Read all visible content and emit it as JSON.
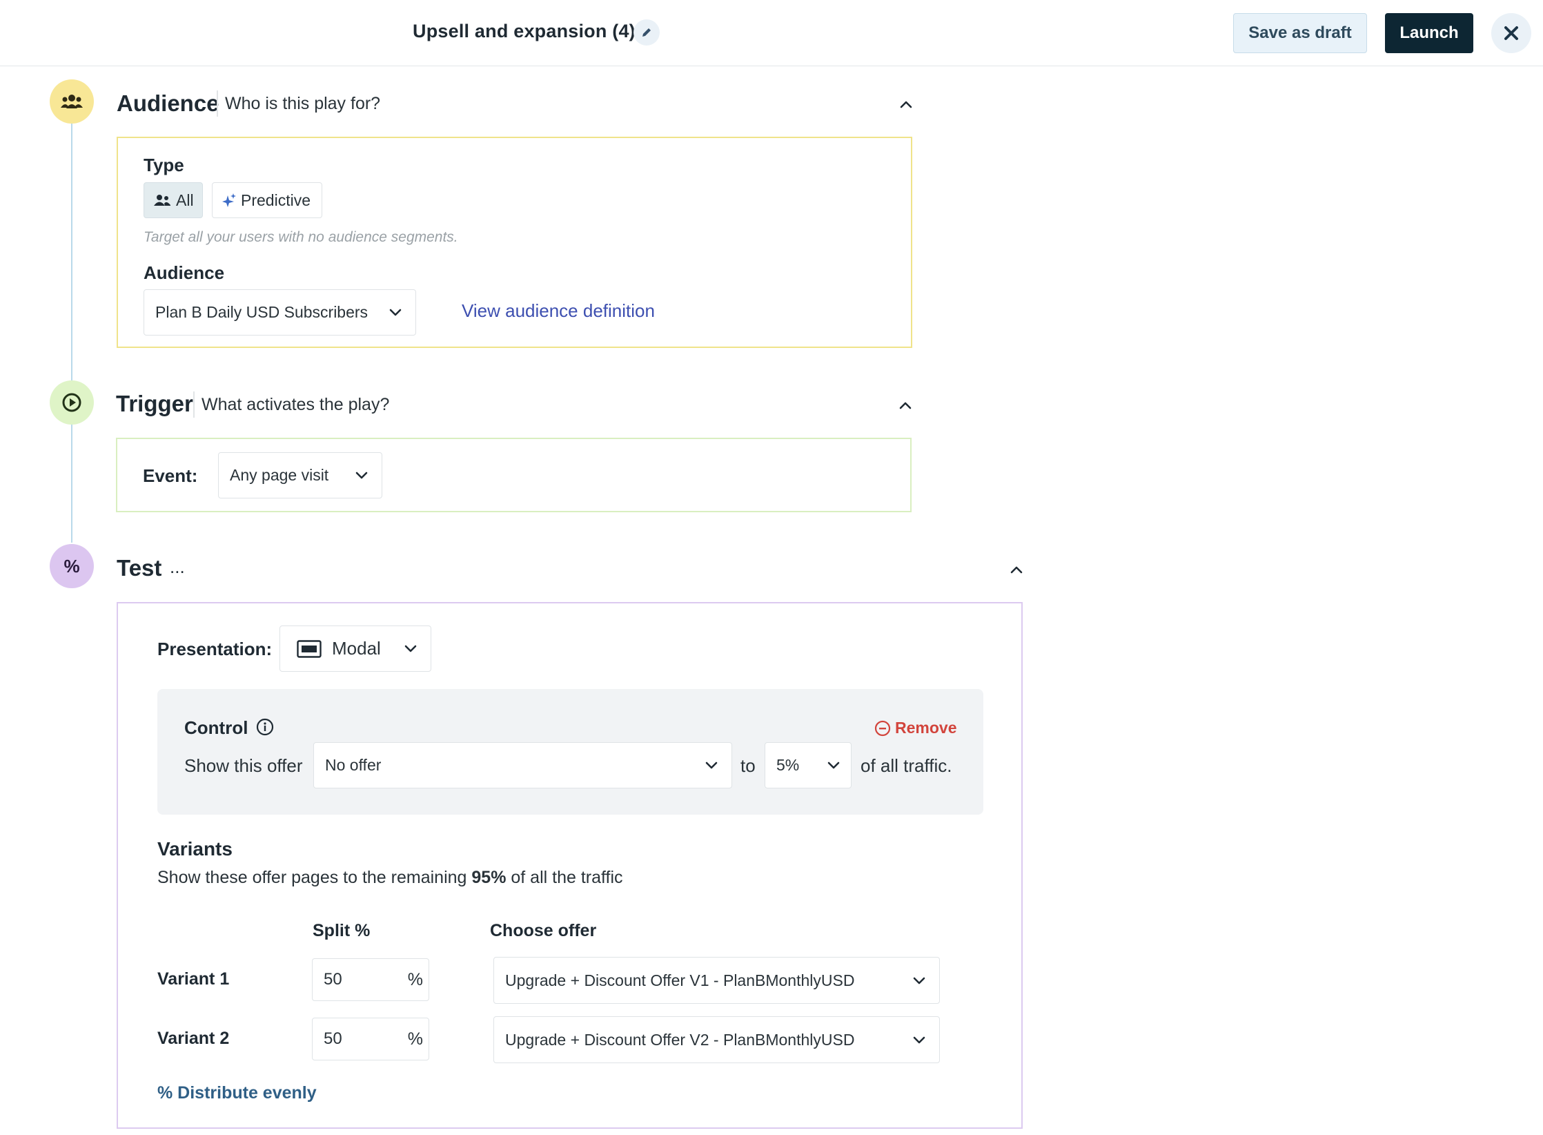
{
  "header": {
    "title": "Upsell and expansion (4)",
    "save_draft_label": "Save as draft",
    "launch_label": "Launch"
  },
  "audience_step": {
    "title": "Audience",
    "subtitle": "Who is this play for?",
    "type_label": "Type",
    "type_options": [
      {
        "label": "All",
        "selected": true,
        "icon": "users-icon"
      },
      {
        "label": "Predictive",
        "selected": false,
        "icon": "sparkle-icon"
      }
    ],
    "type_hint": "Target all your users with no audience segments.",
    "audience_label": "Audience",
    "audience_value": "Plan B Daily USD Subscribers",
    "view_definition_link": "View audience definition",
    "accent_color": "#f5e58f"
  },
  "trigger_step": {
    "title": "Trigger",
    "subtitle": "What activates the play?",
    "event_label": "Event:",
    "event_value": "Any page visit",
    "accent_color": "#dcf2c3"
  },
  "test_step": {
    "title": "Test",
    "more": "...",
    "accent_color": "#dcc6f0",
    "presentation_label": "Presentation:",
    "presentation_value": "Modal",
    "control": {
      "title": "Control",
      "remove_label": "Remove",
      "show_offer_label": "Show this offer",
      "offer_value": "No offer",
      "to_label": "to",
      "percent_value": "5%",
      "suffix": "of all traffic."
    },
    "variants": {
      "title": "Variants",
      "desc_before": "Show these offer pages to the remaining ",
      "desc_bold": "95%",
      "desc_after": " of all the traffic",
      "split_header": "Split %",
      "offer_header": "Choose offer",
      "rows": [
        {
          "name": "Variant 1",
          "split": "50",
          "unit": "%",
          "offer": "Upgrade + Discount Offer V1 - PlanBMonthlyUSD"
        },
        {
          "name": "Variant 2",
          "split": "50",
          "unit": "%",
          "offer": "Upgrade + Discount Offer V2 - PlanBMonthlyUSD"
        }
      ],
      "distribute_label": "% Distribute evenly"
    }
  }
}
